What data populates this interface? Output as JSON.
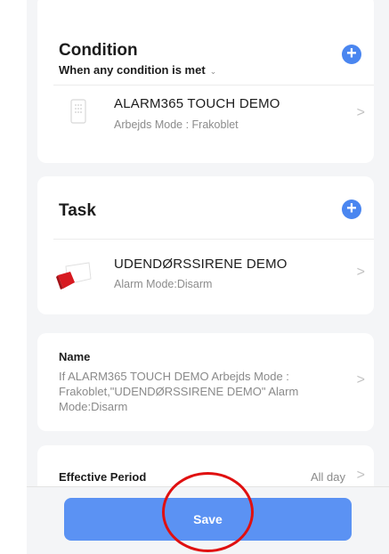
{
  "condition": {
    "title": "Condition",
    "subtitle": "When any condition is met",
    "caret": "⌄",
    "add": "+",
    "item": {
      "name": "ALARM365 TOUCH DEMO",
      "status": "Arbejds Mode : Frakoblet",
      "icon": "keypad-icon"
    }
  },
  "task": {
    "title": "Task",
    "add": "+",
    "item": {
      "name": "UDENDØRSSIRENE DEMO",
      "status": "Alarm Mode:Disarm",
      "icon": "siren-icon"
    }
  },
  "name_section": {
    "label": "Name",
    "value": "If ALARM365 TOUCH DEMO Arbejds Mode : Frakoblet,\"UDENDØRSSIRENE DEMO\" Alarm Mode:Disarm"
  },
  "effective_period": {
    "label": "Effective Period",
    "value": "All day"
  },
  "chevron": ">",
  "save_label": "Save",
  "colors": {
    "accent": "#4a86f0",
    "save_button": "#5b92f3",
    "annotation": "#e01010"
  }
}
